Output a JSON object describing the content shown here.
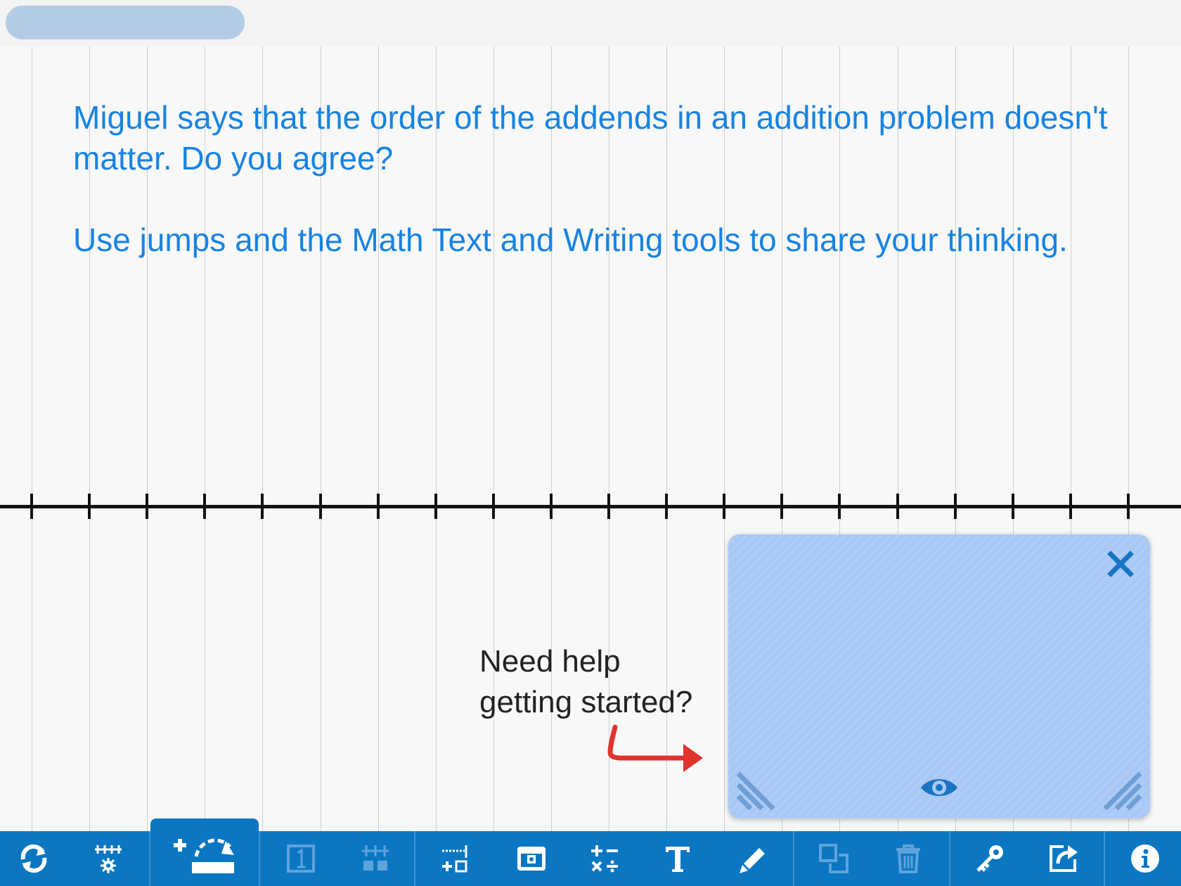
{
  "header": {
    "title": ""
  },
  "prompt": {
    "paragraph1": "Miguel says that the order of the addends in an addition problem doesn't matter. Do you agree?",
    "paragraph2": "Use jumps and the Math Text and Writing tools to share your thinking."
  },
  "help": {
    "line1": "Need help",
    "line2": "getting started?"
  },
  "colors": {
    "prompt_text": "#1783e4",
    "toolbar": "#0b77c2",
    "help_panel": "#a9c9f5",
    "help_icons": "#1a74c4",
    "arrow": "#e0332e",
    "number_line": "#111111"
  },
  "toolbar": {
    "buttons": [
      {
        "id": "reset",
        "icon": "refresh-icon"
      },
      {
        "id": "line-settings",
        "icon": "number-line-settings-icon"
      },
      {
        "id": "add-jump",
        "icon": "add-jump-icon",
        "active": true
      },
      {
        "id": "numbers",
        "icon": "number-box-icon",
        "disabled": true
      },
      {
        "id": "hide-ticks",
        "icon": "hide-number-line-icon",
        "disabled": true
      },
      {
        "id": "add-tick",
        "icon": "add-tick-icon"
      },
      {
        "id": "cover",
        "icon": "cover-box-icon"
      },
      {
        "id": "math-text",
        "icon": "math-operators-icon"
      },
      {
        "id": "text",
        "icon": "text-icon",
        "glyph": "T"
      },
      {
        "id": "writing",
        "icon": "pencil-icon"
      },
      {
        "id": "duplicate",
        "icon": "duplicate-icon",
        "disabled": true
      },
      {
        "id": "delete",
        "icon": "trash-icon",
        "disabled": true
      },
      {
        "id": "key",
        "icon": "key-icon"
      },
      {
        "id": "share",
        "icon": "share-icon"
      },
      {
        "id": "info",
        "icon": "info-icon",
        "glyph": "i"
      }
    ]
  }
}
